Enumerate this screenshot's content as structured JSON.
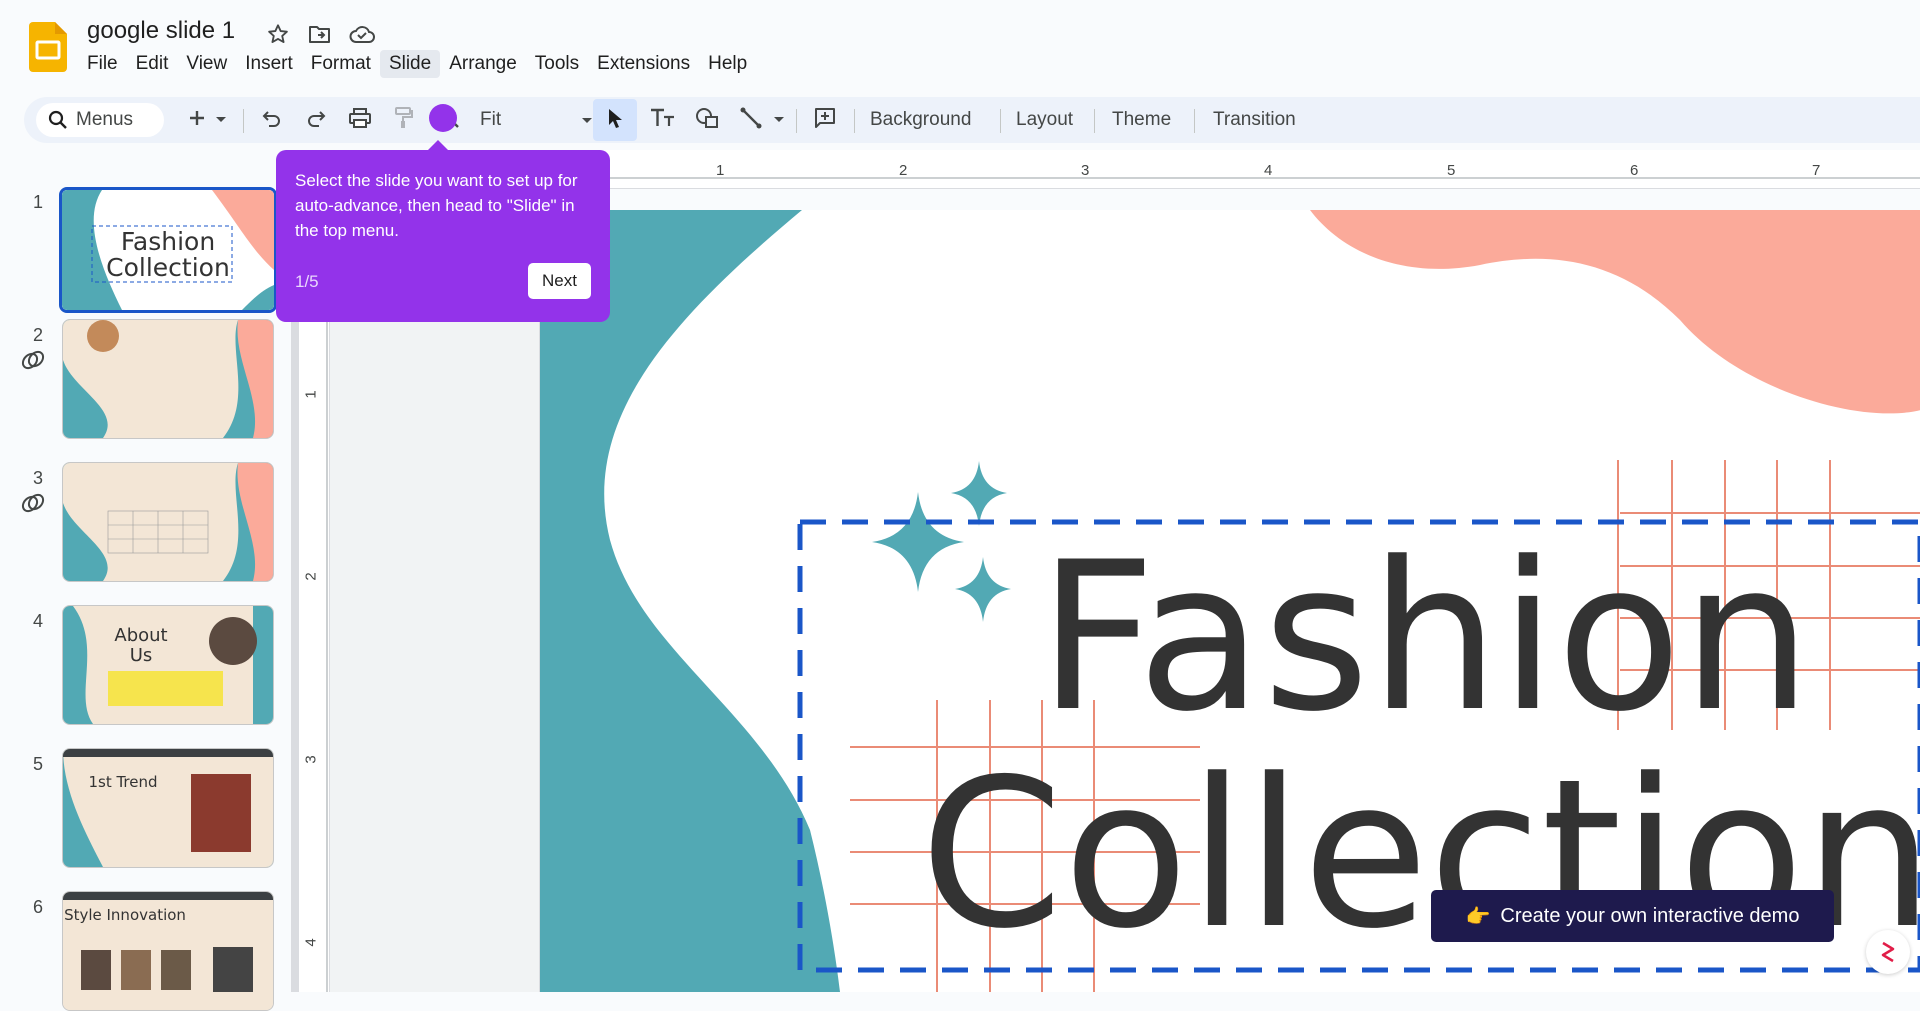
{
  "app": {
    "title": "google slide 1",
    "icons": [
      "star-icon",
      "move-to-folder-icon",
      "cloud-saved-icon"
    ],
    "menu": [
      "File",
      "Edit",
      "View",
      "Insert",
      "Format",
      "Slide",
      "Arrange",
      "Tools",
      "Extensions",
      "Help"
    ],
    "active_menu": "Slide"
  },
  "toolbar": {
    "search_label": "Menus",
    "zoom_value": "Fit",
    "background_label": "Background",
    "layout_label": "Layout",
    "theme_label": "Theme",
    "transition_label": "Transition"
  },
  "ruler": {
    "horizontal": [
      "1",
      "2",
      "3",
      "4",
      "5",
      "6",
      "7"
    ],
    "vertical": [
      "1",
      "2",
      "3",
      "4"
    ]
  },
  "filmstrip": {
    "slides": [
      {
        "number": "1",
        "title": "Fashion Collection",
        "linked": false,
        "selected": true
      },
      {
        "number": "2",
        "title": "",
        "linked": true,
        "selected": false
      },
      {
        "number": "3",
        "title": "",
        "linked": true,
        "selected": false
      },
      {
        "number": "4",
        "title": "About Us",
        "linked": false,
        "selected": false
      },
      {
        "number": "5",
        "title": "1st Trend",
        "linked": false,
        "selected": false
      },
      {
        "number": "6",
        "title": "Style Innovation",
        "linked": false,
        "selected": false
      }
    ]
  },
  "slide": {
    "title_line1": "Fashion",
    "title_line2": "Collection"
  },
  "tooltip": {
    "message": "Select the slide you want to set up for auto-advance, then head to \"Slide\" in the top menu.",
    "step": "1/5",
    "next_label": "Next"
  },
  "cta": {
    "emoji": "👉",
    "label": "Create your own interactive demo"
  },
  "colors": {
    "accent_purple": "#9333ea",
    "teal": "#52a9b4",
    "salmon": "#fbaa9a",
    "dark_text": "#333333",
    "selection_blue": "#1a56c8",
    "cta_bg": "#1e1a4d"
  }
}
